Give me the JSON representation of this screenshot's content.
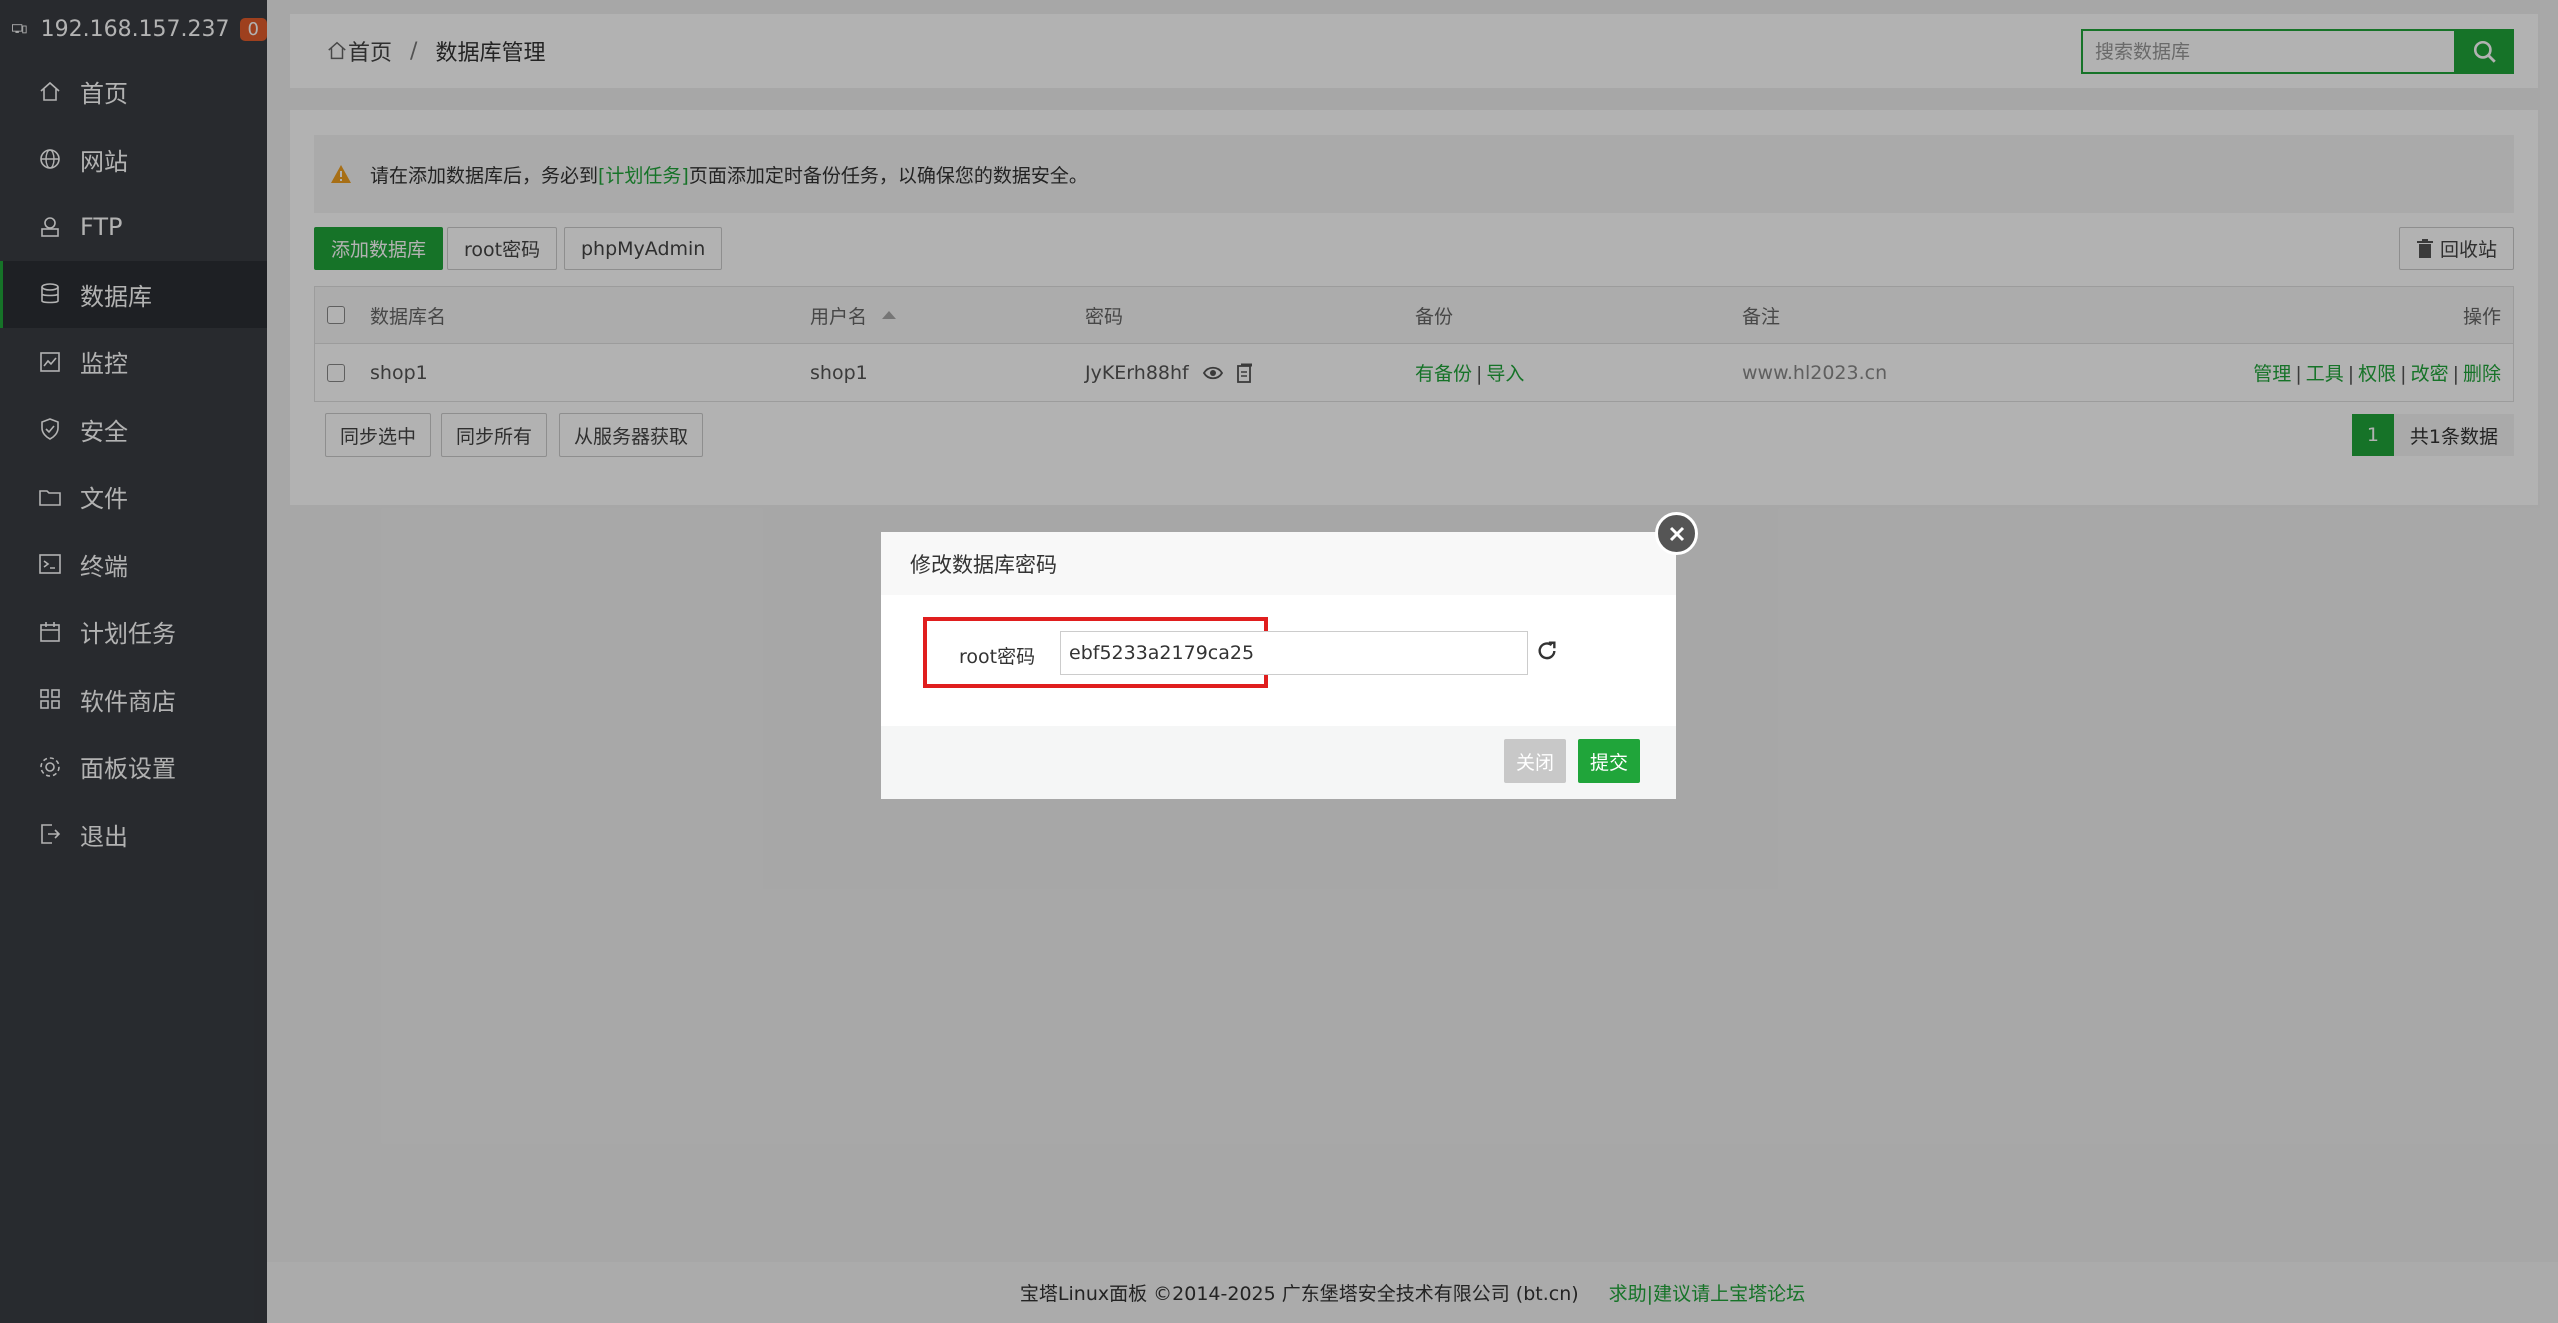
{
  "sidebar": {
    "host": "192.168.157.237",
    "badge": "0",
    "items": [
      {
        "label": "首页"
      },
      {
        "label": "网站"
      },
      {
        "label": "FTP"
      },
      {
        "label": "数据库"
      },
      {
        "label": "监控"
      },
      {
        "label": "安全"
      },
      {
        "label": "文件"
      },
      {
        "label": "终端"
      },
      {
        "label": "计划任务"
      },
      {
        "label": "软件商店"
      },
      {
        "label": "面板设置"
      },
      {
        "label": "退出"
      }
    ]
  },
  "breadcrumb": {
    "home": "首页",
    "sep": "/",
    "current": "数据库管理"
  },
  "search": {
    "placeholder": "搜索数据库"
  },
  "alert": {
    "pre": "请在添加数据库后，务必到",
    "link": "[计划任务]",
    "post": "页面添加定时备份任务，以确保您的数据安全。"
  },
  "toolbar": {
    "add": "添加数据库",
    "root_pwd": "root密码",
    "phpmyadmin": "phpMyAdmin",
    "recycle": "回收站"
  },
  "table": {
    "headers": {
      "name": "数据库名",
      "user": "用户名",
      "password": "密码",
      "backup": "备份",
      "note": "备注",
      "ops": "操作"
    },
    "rows": [
      {
        "name": "shop1",
        "user": "shop1",
        "password": "JyKErh88hf",
        "backup": "有备份",
        "import": "导入",
        "note": "www.hl2023.cn",
        "ops": {
          "manage": "管理",
          "tools": "工具",
          "perm": "权限",
          "chpwd": "改密",
          "delete": "删除"
        }
      }
    ]
  },
  "bottom_buttons": {
    "sync_selected": "同步选中",
    "sync_all": "同步所有",
    "fetch": "从服务器获取"
  },
  "pager": {
    "current": "1",
    "total": "共1条数据"
  },
  "footer": {
    "copyright": "宝塔Linux面板 ©2014-2025 广东堡塔安全技术有限公司 (bt.cn)",
    "help": "求助|建议请上宝塔论坛"
  },
  "modal": {
    "title": "修改数据库密码",
    "label": "root密码",
    "value": "ebf5233a2179ca25",
    "close": "关闭",
    "submit": "提交"
  },
  "colors": {
    "accent": "#20a53a",
    "sidebar": "#3a3d43",
    "highlight": "#e01e1e",
    "badge": "#e25c2b"
  }
}
